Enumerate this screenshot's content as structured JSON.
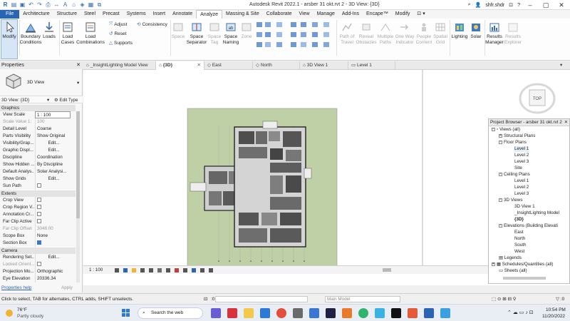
{
  "window": {
    "title": "Autodesk Revit 2022.1 - arsber 31 okt.rvt 2 - 3D View: {3D}",
    "user": "shfr.shdr"
  },
  "ribbon_tabs": [
    "File",
    "Architecture",
    "Structure",
    "Steel",
    "Precast",
    "Systems",
    "Insert",
    "Annotate",
    "Analyze",
    "Massing & Site",
    "Collaborate",
    "View",
    "Manage",
    "Add-Ins",
    "Encape™",
    "Modify"
  ],
  "ribbon": {
    "modify": "Modify",
    "boundary": "Boundary\nConditions",
    "loads": "Loads",
    "load_cases": "Load\nCases",
    "load_combinations": "Load\nCombinations",
    "adjust": "Adjust",
    "reset": "Reset",
    "supports": "Supports",
    "consistency": "Consistency",
    "space": "Space",
    "space_separator": "Space\nSeparator",
    "space_tag": "Space\nTag",
    "space_naming": "Space\nNaming",
    "zone": "Zone",
    "path_of_travel": "Path of\nTravel",
    "reveal_obstacles": "Reveal\nObstacles",
    "multiple_paths": "Multiple\nPaths",
    "one_way_indicator": "One Way\nIndicator",
    "people_content": "People\nContent",
    "spatial_grid": "Spatial\nGrid",
    "lighting": "Lighting",
    "solar": "Solar",
    "results_manager": "Results\nManager",
    "results_explorer": "Results\nExplorer"
  },
  "view_tabs": [
    "_InsightLighting Model View",
    "{3D}",
    "East",
    "North",
    "3D View 1",
    "Level 1"
  ],
  "properties": {
    "title": "Properties",
    "type_name": "3D View",
    "selector": "3D View: {3D}",
    "edit_type": "Edit Type",
    "sections": {
      "graphics": "Graphics",
      "extents": "Extents",
      "camera": "Camera"
    },
    "rows": [
      {
        "k": "View Scale",
        "v": "1 : 100"
      },
      {
        "k": "Scale Value 1:",
        "v": "100"
      },
      {
        "k": "Detail Level",
        "v": "Coarse"
      },
      {
        "k": "Parts Visibility",
        "v": "Show Original"
      },
      {
        "k": "Visibility/Grap...",
        "v": "Edit..."
      },
      {
        "k": "Graphic Displ...",
        "v": "Edit..."
      },
      {
        "k": "Discipline",
        "v": "Coordination"
      },
      {
        "k": "Show Hidden ...",
        "v": "By Discipline"
      },
      {
        "k": "Default Analys...",
        "v": "Solar Analysi..."
      },
      {
        "k": "Show Grids",
        "v": "Edit..."
      },
      {
        "k": "Sun Path",
        "v": ""
      },
      {
        "k": "Crop View",
        "v": ""
      },
      {
        "k": "Crop Region V...",
        "v": ""
      },
      {
        "k": "Annotation Cr...",
        "v": ""
      },
      {
        "k": "Far Clip Active",
        "v": ""
      },
      {
        "k": "Far Clip Offset",
        "v": "3048.00"
      },
      {
        "k": "Scope Box",
        "v": "None"
      },
      {
        "k": "Section Box",
        "v": ""
      },
      {
        "k": "Rendering Set...",
        "v": "Edit..."
      },
      {
        "k": "Locked Orient...",
        "v": ""
      },
      {
        "k": "Projection Mo...",
        "v": "Orthographic"
      },
      {
        "k": "Eye Elevation",
        "v": "20336.34"
      }
    ],
    "help": "Properties help",
    "apply": "Apply"
  },
  "project_browser": {
    "title": "Project Browser - arsber 31 okt.rvt 2",
    "items": [
      {
        "label": "Views (all)",
        "level": 0
      },
      {
        "label": "Structural Plans",
        "level": 1
      },
      {
        "label": "Floor Plans",
        "level": 1
      },
      {
        "label": "Level 1",
        "level": 2
      },
      {
        "label": "Level 2",
        "level": 2
      },
      {
        "label": "Level 3",
        "level": 2
      },
      {
        "label": "Site",
        "level": 2
      },
      {
        "label": "Ceiling Plans",
        "level": 1
      },
      {
        "label": "Level 1",
        "level": 2
      },
      {
        "label": "Level 2",
        "level": 2
      },
      {
        "label": "Level 3",
        "level": 2
      },
      {
        "label": "3D Views",
        "level": 1
      },
      {
        "label": "3D View 1",
        "level": 2
      },
      {
        "label": "_InsightLighting Model",
        "level": 2
      },
      {
        "label": "{3D}",
        "level": 2
      },
      {
        "label": "Elevations (Building Elevati",
        "level": 1
      },
      {
        "label": "East",
        "level": 2
      },
      {
        "label": "North",
        "level": 2
      },
      {
        "label": "South",
        "level": 2
      },
      {
        "label": "West",
        "level": 2
      },
      {
        "label": "Legends",
        "level": 0
      },
      {
        "label": "Schedules/Quantities (all)",
        "level": 0
      },
      {
        "label": "Sheets (all)",
        "level": 0
      }
    ]
  },
  "view_control": {
    "scale": "1 : 100"
  },
  "viewcube": {
    "label": "TOP"
  },
  "status": {
    "hint": "Click to select, TAB for alternates, CTRL adds, SHIFT unselects.",
    "zero": ":0",
    "model": "Main Model"
  },
  "taskbar": {
    "temp": "76°F",
    "weather": "Partly cloudy",
    "search": "Search the web",
    "time": "10:54 PM",
    "date": "11/20/2022"
  }
}
